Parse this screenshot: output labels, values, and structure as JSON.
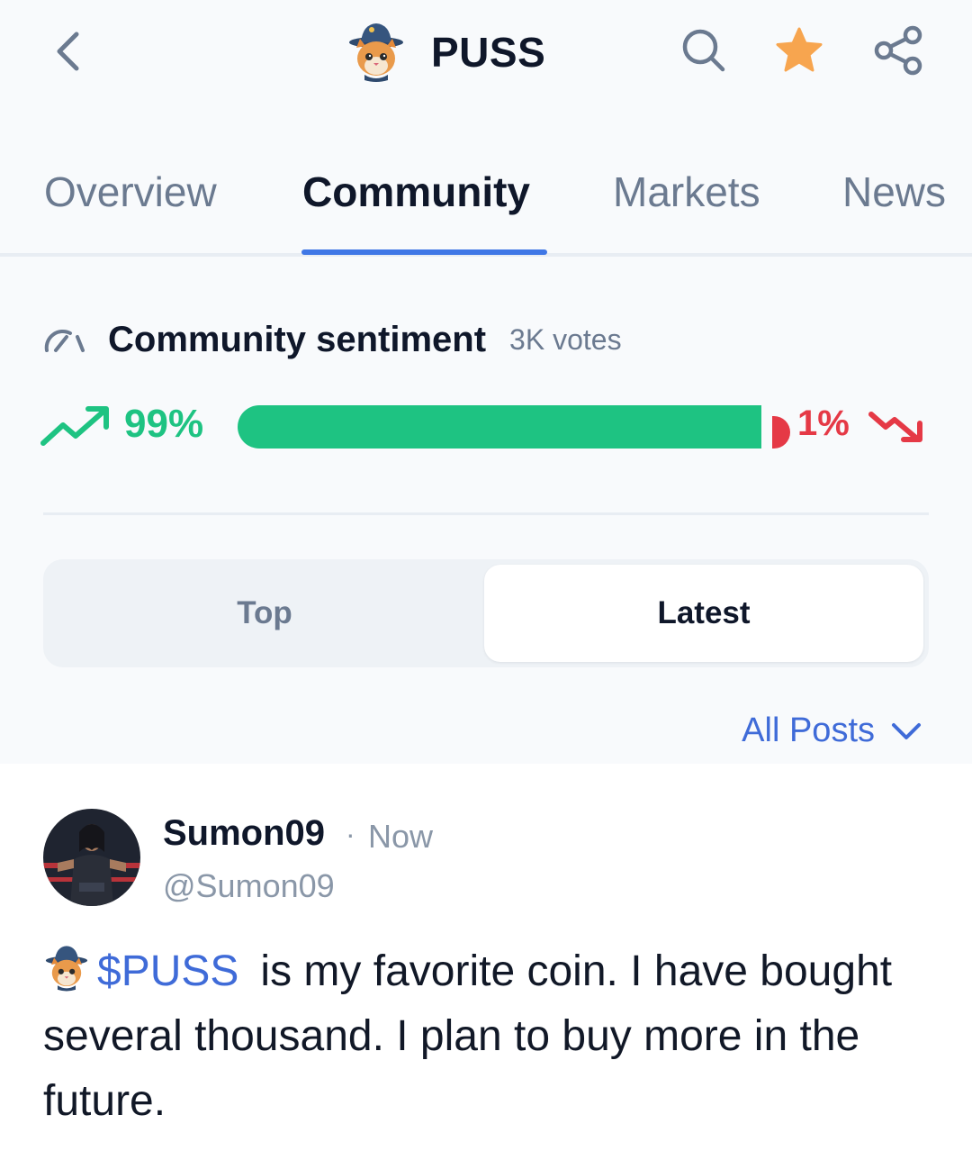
{
  "header": {
    "title": "PUSS",
    "back_icon": "chevron-left-icon",
    "search_icon": "search-icon",
    "favorite_icon": "star-icon",
    "share_icon": "share-icon",
    "favorite_color": "#F7A54F"
  },
  "tabs": [
    {
      "label": "Overview",
      "active": false
    },
    {
      "label": "Community",
      "active": true
    },
    {
      "label": "Markets",
      "active": false
    },
    {
      "label": "News",
      "active": false
    }
  ],
  "sentiment": {
    "title": "Community sentiment",
    "votes": "3K votes",
    "bullish_label": "99%",
    "bearish_label": "1%",
    "bullish_fraction": 0.99,
    "bearish_fraction": 0.01,
    "bullish_color": "#1EC382",
    "bearish_color": "#E53946"
  },
  "segment": {
    "options": [
      "Top",
      "Latest"
    ],
    "selected": "Latest"
  },
  "filter": {
    "label": "All Posts"
  },
  "post": {
    "author": "Sumon09",
    "separator": "·",
    "time": "Now",
    "handle": "@Sumon09",
    "ticker": "$PUSS",
    "text": "is my favorite coin. I have bought several thousand. I plan to buy more in the future."
  },
  "colors": {
    "accent": "#3F77E6",
    "link": "#3F6BD8",
    "muted": "#6B7A90"
  }
}
